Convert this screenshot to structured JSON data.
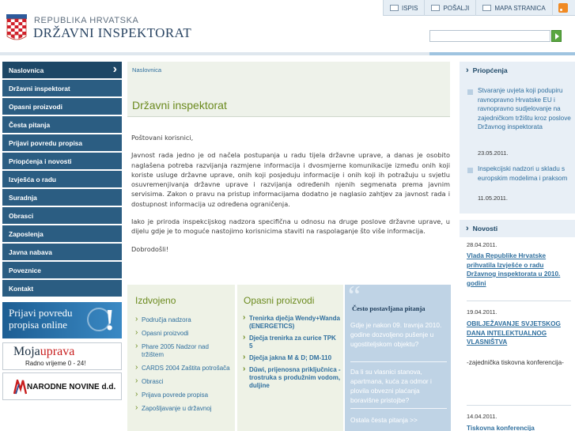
{
  "header": {
    "country": "REPUBLIKA HRVATSKA",
    "agency": "DRŽAVNI INSPEKTORAT",
    "toolbar": [
      {
        "label": "ISPIS",
        "icon": "print-icon"
      },
      {
        "label": "POŠALJI",
        "icon": "mail-icon"
      },
      {
        "label": "MAPA STRANICA",
        "icon": "sitemap-icon"
      }
    ],
    "rss_icon": "rss-icon",
    "search": {
      "value": "",
      "button_icon": "arrow-right-icon"
    }
  },
  "colors": {
    "nav": "#2b5d82",
    "accent_green": "#6b8a1e",
    "link_blue": "#2f6f9e",
    "faq_box": "#bfd3e5"
  },
  "nav": {
    "items": [
      "Naslovnica",
      "Državni inspektorat",
      "Opasni proizvodi",
      "Česta pitanja",
      "Prijavi povredu propisa",
      "Priopćenja i novosti",
      "Izvješća o radu",
      "Suradnja",
      "Obrasci",
      "Zaposlenja",
      "Javna nabava",
      "Poveznice",
      "Kontakt"
    ],
    "active_index": 0
  },
  "banners": {
    "prijavi": {
      "line1": "Prijavi povredu",
      "line2": "propisa online",
      "mark": "!"
    },
    "moja": {
      "logo_a": "Moja",
      "logo_b": "uprava",
      "hours": "Radno vrijeme 0 - 24!"
    },
    "nn": {
      "label": "NARODNE NOVINE d.d."
    }
  },
  "main": {
    "breadcrumb": "Naslovnica",
    "title": "Državni inspektorat",
    "paragraphs": [
      "Poštovani korisnici,",
      "Javnost rada jedno je od načela postupanja u radu tijela državne uprave, a danas je osobito naglašena potreba razvijanja razmjene informacija i dvosmjerne komunikacije između onih koji koriste usluge državne uprave, onih koji posjeduju informacije i onih koji ih potražuju u svjetlu osuvremenjivanja državne uprave i razvijanja određenih njenih segmenata prema javnim servisima. Zakon o pravu na pristup informacijama dodatno je naglasio zahtjev za javnost rada i dostupnost informacija uz određena ograničenja.",
      "Iako je priroda inspekcijskog nadzora specifična u odnosu na druge poslove državne uprave, u dijelu gdje je to moguće nastojimo korisnicima staviti na raspolaganje što više informacija.",
      "Dobrodošli!"
    ]
  },
  "izdvojeno": {
    "title": "Izdvojeno",
    "items": [
      "Područja nadzora",
      "Opasni proizvodi",
      "Phare 2005 Nadzor nad tržištem",
      "CARDS 2004 Zaštita potrošača",
      "Obrasci",
      "Prijava povrede propisa",
      "Zapošljavanje u državnoj"
    ]
  },
  "opasni": {
    "title": "Opasni proizvodi",
    "items": [
      "Trenirka dječja Wendy+Wanda (ENERGETICS)",
      "Dječja trenirka za curice TPK 5",
      "Dječja jakna M & D; DM-110",
      "Dūwi, prijenosna priključnica - trostruka s produžnim vodom, duljine"
    ]
  },
  "faq": {
    "title": "Često postavljana pitanja",
    "quote_glyph": "“",
    "questions": [
      "Gdje je nakon 09. travnja 2010. godine dozvoljeno pušenje u ugostiteljskom objektu?",
      "Da li su vlasnici stanova, apartmana, kuća za odmor i plovila obvezni plaćanja boravišne pristojbe?"
    ],
    "more": "Ostala česta pitanja >>"
  },
  "priopcenja": {
    "title": "Priopćenja",
    "items": [
      {
        "text": "Stvaranje uvjeta koji podupiru ravnopravno Hrvatske EU i ravnopravno sudjelovanje na zajedničkom tržištu kroz poslove Državnog inspektorata",
        "date": "23.05.2011."
      },
      {
        "text": "Inspekcijski nadzori u skladu s europskim modelima i praksom",
        "date": "11.05.2011."
      }
    ]
  },
  "novosti": {
    "title": "Novosti",
    "items": [
      {
        "date": "28.04.2011.",
        "title": "Vlada Republike Hrvatske prihvatila Izvješće o radu Državnog inspektorata u 2010. godini"
      },
      {
        "date": "19.04.2011.",
        "title": "OBILJEŽAVANJE SVJETSKOG DANA INTELEKTUALNOG VLASNIŠTVA",
        "text": "-zajednička tiskovna konferencija-"
      },
      {
        "date": "14.04.2011.",
        "title": "Tiskovna konferencija"
      }
    ]
  }
}
